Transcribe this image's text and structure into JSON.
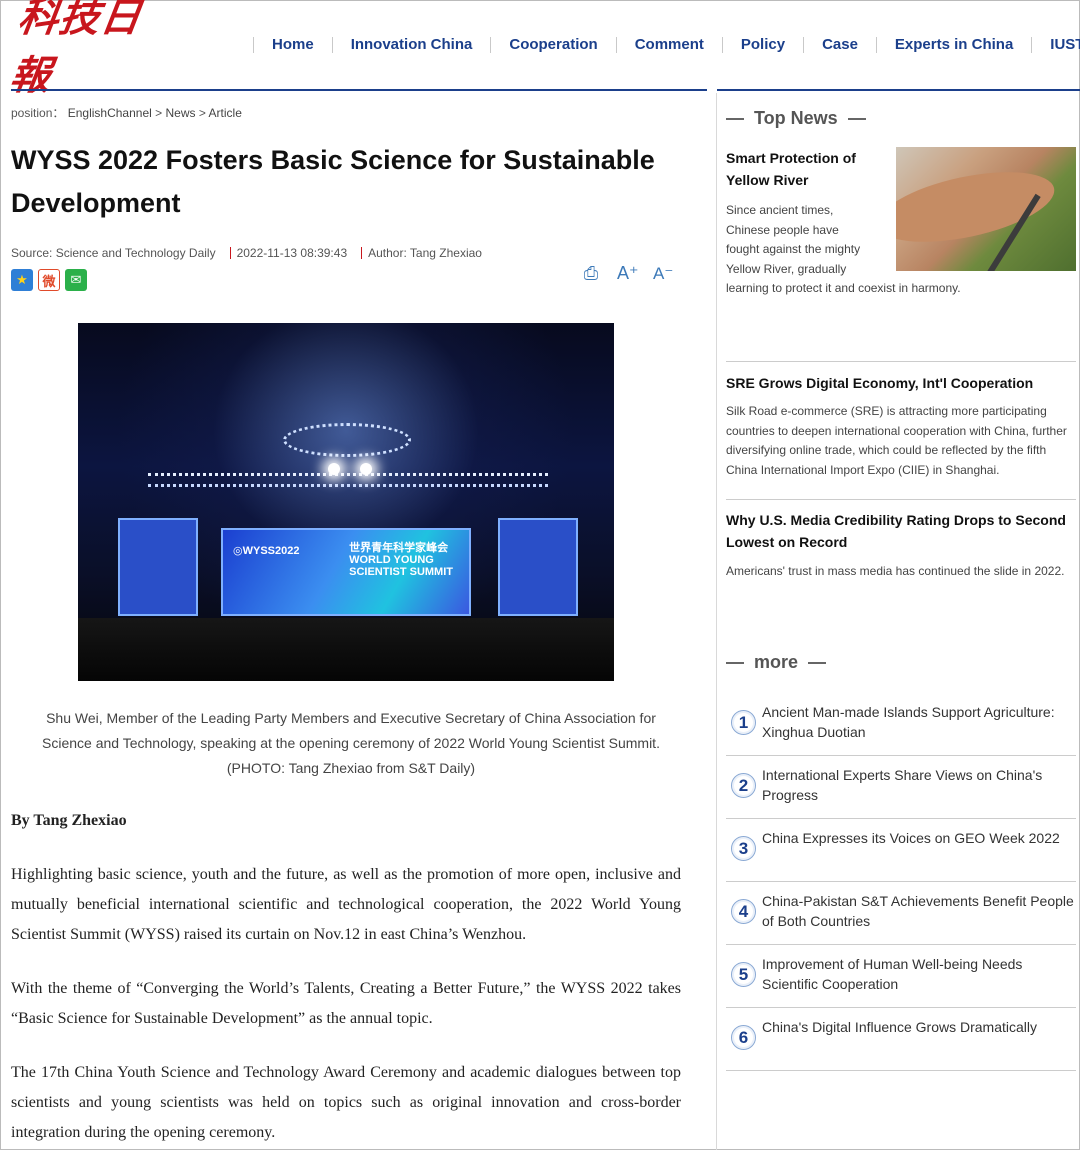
{
  "logo": {
    "text": "科技日報"
  },
  "nav": [
    "Home",
    "Innovation China",
    "Cooperation",
    "Comment",
    "Policy",
    "Case",
    "Experts in China",
    "IUSTC"
  ],
  "breadcrumb": {
    "label": "position：",
    "items": [
      "EnglishChannel",
      "News",
      "Article"
    ],
    "separator": ">"
  },
  "article": {
    "title": "WYSS 2022 Fosters Basic Science for Sustainable Development",
    "source": "Source: Science and Technology Daily",
    "datetime": "2022-11-13 08:39:43",
    "author": "Author: Tang Zhexiao",
    "photo_text": {
      "logo": "◎WYSS2022",
      "line1": "世界青年科学家峰会",
      "line2": "WORLD YOUNG",
      "line3": "SCIENTIST SUMMIT"
    },
    "caption": [
      "Shu Wei, Member of the Leading Party Members and Executive Secretary of China Association for",
      "Science and Technology, speaking at the opening ceremony of 2022 World Young Scientist Summit.",
      "(PHOTO: Tang Zhexiao from S&T Daily)"
    ],
    "byline": "By Tang Zhexiao",
    "paragraphs": [
      "Highlighting basic science, youth and the future, as well as the promotion of more open, inclusive and mutually beneficial international scientific and technological cooperation, the 2022 World Young Scientist Summit (WYSS) raised its curtain on Nov.12 in east China’s Wenzhou.",
      "With the theme of “Converging the World’s Talents, Creating a Better Future,” the WYSS 2022 takes “Basic Science for Sustainable Development” as the annual topic.",
      "The 17th China Youth Science and Technology Award Ceremony and academic dialogues between top scientists and young scientists was held on topics such as original innovation and cross-border integration during the opening ceremony."
    ]
  },
  "share": {
    "star": "★",
    "weibo": "微",
    "wechat": "✉"
  },
  "tools": {
    "print": "⎙",
    "font_up": "A⁺",
    "font_down": "A⁻"
  },
  "top_news": {
    "heading": "Top News",
    "items": [
      {
        "title": "Smart Protection of Yellow River",
        "desc_lines": [
          "Since ancient times,",
          "Chinese people have",
          "fought against the mighty",
          "Yellow River, gradually",
          "learning to protect it and coexist in harmony."
        ]
      },
      {
        "title": "SRE Grows Digital Economy, Int'l Cooperation",
        "desc": "Silk Road e-commerce (SRE) is attracting more participating countries to deepen international cooperation with China, further diversifying online trade, which could be reflected by the fifth China International Import Expo (CIIE) in Shanghai."
      },
      {
        "title": "Why U.S. Media Credibility Rating Drops to Second Lowest on Record",
        "desc": "Americans' trust in mass media has continued the slide in 2022."
      }
    ]
  },
  "more": {
    "heading": "more",
    "items": [
      {
        "num": "1",
        "title": "Ancient Man-made Islands Support Agriculture: Xinghua Duotian"
      },
      {
        "num": "2",
        "title": "International Experts Share Views on China's Progress"
      },
      {
        "num": "3",
        "title": "China Expresses its Voices on GEO Week 2022"
      },
      {
        "num": "4",
        "title": "China-Pakistan S&T Achievements Benefit People of Both Countries"
      },
      {
        "num": "5",
        "title": "Improvement of Human Well-being Needs Scientific Cooperation"
      },
      {
        "num": "6",
        "title": "China's Digital Influence Grows Dramatically"
      }
    ]
  }
}
